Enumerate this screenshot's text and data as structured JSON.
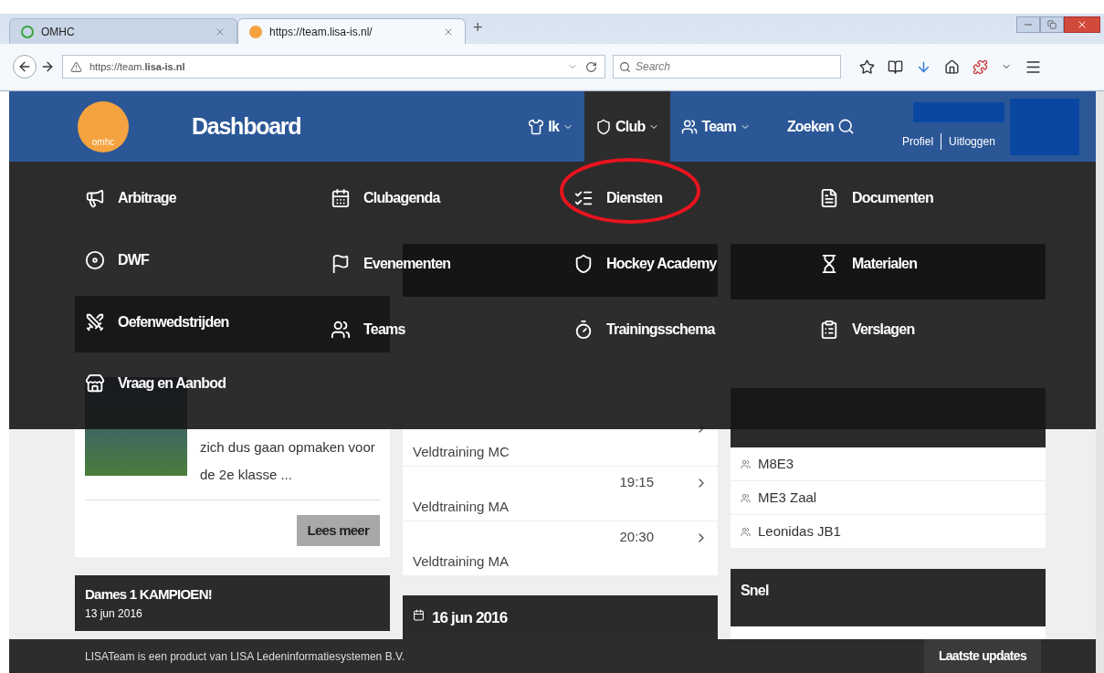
{
  "browser": {
    "tabs": [
      {
        "title": "OMHC",
        "selected": false
      },
      {
        "title": "https://team.lisa-is.nl/",
        "selected": true
      }
    ],
    "new_tab": "+",
    "address": "https://team.**lisa-is.nl**",
    "search": {
      "placeholder": "Search"
    }
  },
  "header": {
    "logo_text": "omhc",
    "title": "Dashboard",
    "nav": [
      {
        "label": "Ik",
        "selected": false,
        "dropdown": true
      },
      {
        "label": "Club",
        "selected": true,
        "dropdown": true
      },
      {
        "label": "Team",
        "selected": false,
        "dropdown": true
      },
      {
        "label": "Zoeken",
        "selected": false,
        "dropdown": false
      }
    ],
    "user_links": [
      "Profiel",
      "Uitloggen"
    ]
  },
  "menu": {
    "columns": [
      [
        {
          "label": "Arbitrage",
          "circled": false
        },
        {
          "label": "DWF",
          "circled": false
        },
        {
          "label": "Oefenwedstrijden",
          "circled": false
        },
        {
          "label": "Vraag en Aanbod",
          "circled": false
        }
      ],
      [
        {
          "label": "Clubagenda",
          "circled": false
        },
        {
          "label": "Evenementen",
          "circled": false
        },
        {
          "label": "Teams",
          "circled": false
        }
      ],
      [
        {
          "label": "Diensten",
          "circled": true
        },
        {
          "label": "Hockey Academy",
          "circled": false
        },
        {
          "label": "Trainingsschema",
          "circled": false
        }
      ],
      [
        {
          "label": "Documenten",
          "circled": false
        },
        {
          "label": "Materialen",
          "circled": false
        },
        {
          "label": "Verslagen",
          "circled": false
        }
      ]
    ]
  },
  "news": {
    "paragraph": "zich dus gaan opmaken voor de 2e klasse ...",
    "button": "Lees meer",
    "next": {
      "title": "Dames 1 KAMPIOEN!",
      "date": "13 jun 2016"
    }
  },
  "activities": {
    "rows": [
      {
        "title": "Veldtraining MC"
      },
      {
        "time": "19:15",
        "title": "Veldtraining MA"
      },
      {
        "time": "20:30",
        "title": "Veldtraining MA"
      }
    ],
    "next_day": "16 jun 2016"
  },
  "favorite_teams": {
    "rows": [
      "M8E3",
      "ME3 Zaal",
      "Leonidas JB1"
    ]
  },
  "quick": {
    "title": "Snel"
  },
  "footer": {
    "text": "LISATeam is een product van LISA Ledeninformatiesystemen B.V.",
    "button": "Laatste updates"
  }
}
